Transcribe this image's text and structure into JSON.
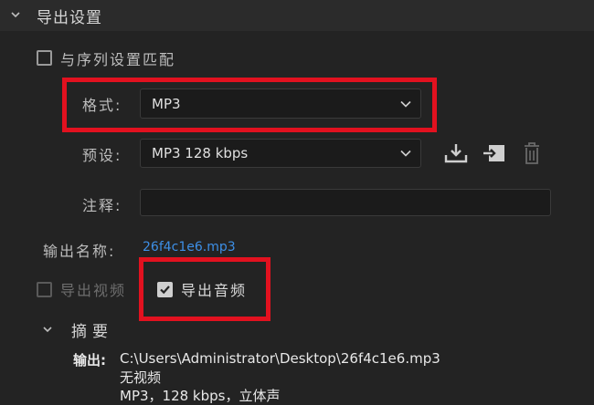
{
  "section": {
    "title": "导出设置"
  },
  "match_sequence": {
    "label": "与序列设置匹配",
    "checked": false
  },
  "format": {
    "label": "格式:",
    "value": "MP3"
  },
  "preset": {
    "label": "预设:",
    "value": "MP3 128 kbps"
  },
  "comment": {
    "label": "注释:",
    "value": ""
  },
  "output_name": {
    "label": "输出名称:",
    "value": "26f4c1e6.mp3"
  },
  "export_video": {
    "label": "导出视频",
    "checked": false,
    "enabled": false
  },
  "export_audio": {
    "label": "导出音频",
    "checked": true
  },
  "summary": {
    "title": "摘要",
    "output_label": "输出:",
    "output_path": "C:\\Users\\Administrator\\Desktop\\26f4c1e6.mp3",
    "line2": "无视频",
    "line3": "MP3，128 kbps，立体声"
  },
  "colors": {
    "highlight": "#e2111f",
    "link": "#3d8fe6",
    "background": "#232323"
  },
  "icons": [
    "chevron-down-icon",
    "save-preset-icon",
    "import-preset-icon",
    "delete-preset-icon",
    "checkmark-icon"
  ]
}
